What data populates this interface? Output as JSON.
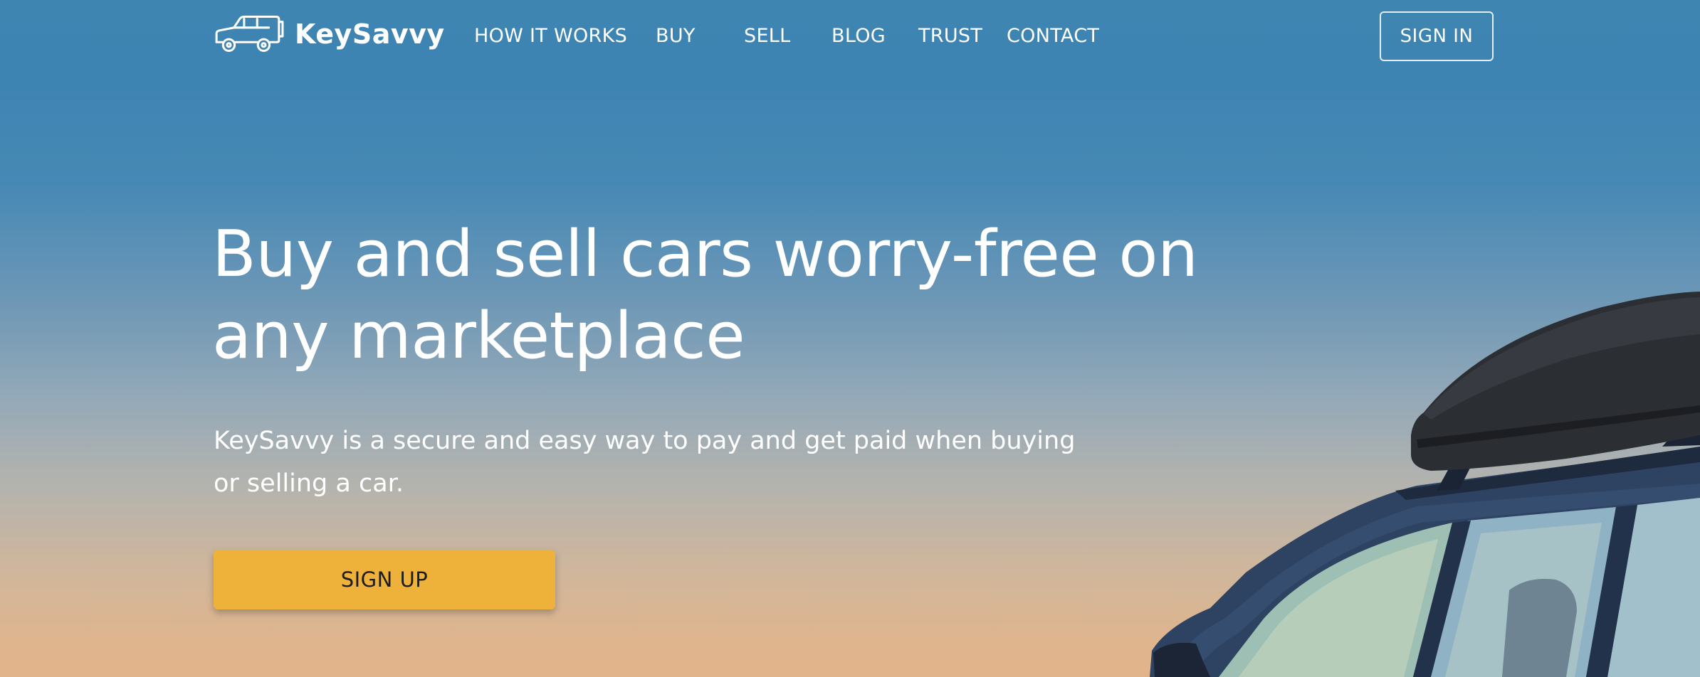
{
  "brand": {
    "name": "KeySavvy",
    "logo_icon": "car-icon"
  },
  "nav": {
    "links": [
      "HOW IT WORKS",
      "BUY",
      "SELL",
      "BLOG",
      "TRUST",
      "CONTACT"
    ],
    "signin_label": "SIGN IN"
  },
  "hero": {
    "headline_line1": "Buy and sell cars worry-free on",
    "headline_line2": "any marketplace",
    "subtext_line1": "KeySavvy is a secure and easy way to pay and get paid when buying",
    "subtext_line2": "or selling a car.",
    "cta_label": "SIGN UP",
    "image": "car-with-roof-box-photo"
  },
  "colors": {
    "sky_top": "#3f85b2",
    "sky_bottom": "#e2b48b",
    "cta": "#eeb23b",
    "car_body": "#2e4362",
    "text": "#ffffff"
  }
}
